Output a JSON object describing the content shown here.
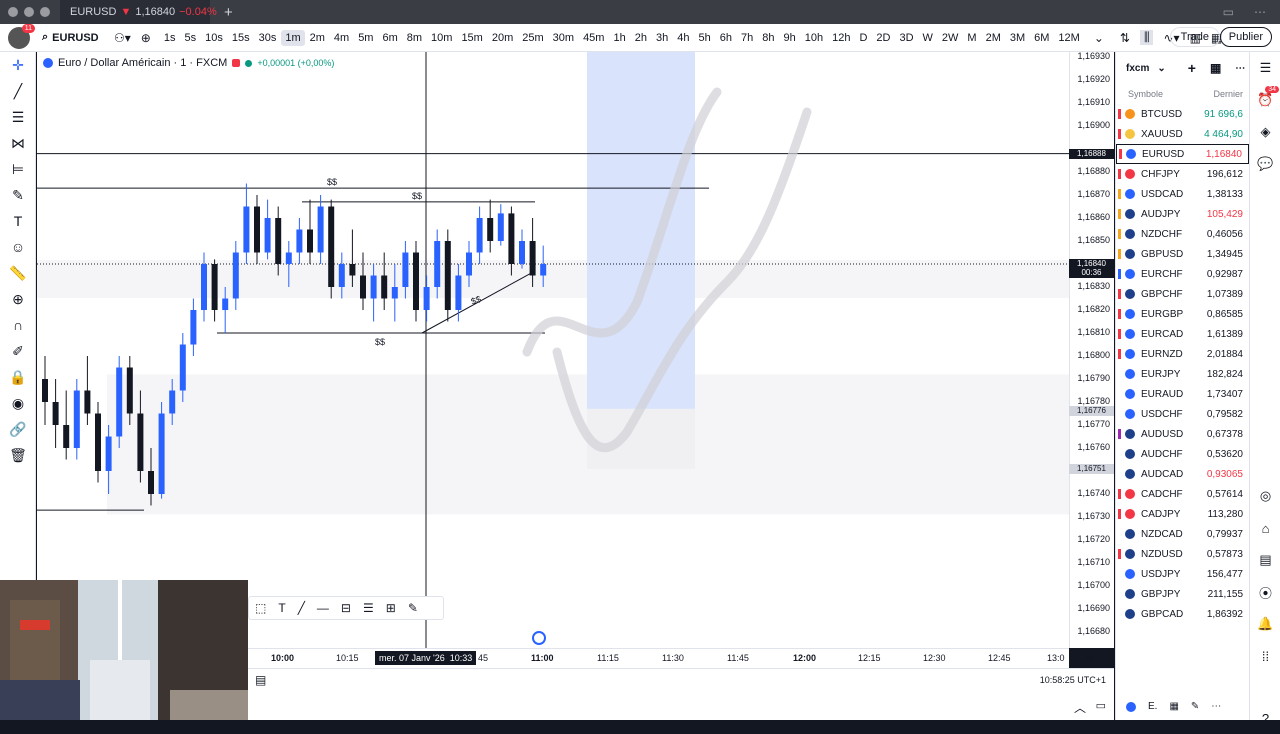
{
  "tab": {
    "symbol": "EURUSD",
    "price": "1,16840",
    "change": "−0.04%"
  },
  "toolbar": {
    "symbol": "EURUSD",
    "notification_count": "11",
    "timeframes": [
      "1s",
      "5s",
      "10s",
      "15s",
      "30s",
      "1m",
      "2m",
      "4m",
      "5m",
      "6m",
      "8m",
      "10m",
      "15m",
      "20m",
      "25m",
      "30m",
      "45m",
      "1h",
      "2h",
      "3h",
      "4h",
      "5h",
      "6h",
      "7h",
      "8h",
      "9h",
      "10h",
      "12h",
      "D",
      "2D",
      "3D",
      "W",
      "2W",
      "M",
      "2M",
      "3M",
      "6M",
      "12M"
    ],
    "active_timeframe": "1m",
    "trade_label": "Trade",
    "publish_label": "Publier"
  },
  "chart": {
    "title": "Euro / Dollar Américain · 1 · FXCM",
    "change": "+0,00001 (+0,00%)",
    "annotations": [
      "$$",
      "$$",
      "$$",
      "$$"
    ],
    "crosshair_date": "mer. 07 Janv '26",
    "crosshair_time": "10:33",
    "hidden_time_fragment": "45"
  },
  "price_axis": {
    "ticks": [
      "1,16930",
      "1,16920",
      "1,16910",
      "1,16900",
      "1,16880",
      "1,16870",
      "1,16860",
      "1,16850",
      "1,16830",
      "1,16820",
      "1,16810",
      "1,16800",
      "1,16790",
      "1,16780",
      "1,16770",
      "1,16760",
      "1,16740",
      "1,16730",
      "1,16720",
      "1,16710",
      "1,16700",
      "1,16690",
      "1,16680"
    ],
    "crosshair_label": "1,16888",
    "last_price_label": "1,16840",
    "countdown": "00:36",
    "level1_label": "1,16776",
    "level2_label": "1,16751"
  },
  "time_axis": {
    "ticks": [
      "10:00",
      "10:15",
      "11:00",
      "11:15",
      "11:30",
      "11:45",
      "12:00",
      "12:15",
      "12:30",
      "12:45",
      "13:0"
    ]
  },
  "clock": "10:58:25 UTC+1",
  "watchlist": {
    "title": "fxcm",
    "col_symbol": "Symbole",
    "col_last": "Dernier",
    "badge": "34",
    "bottom_label": "E.",
    "items": [
      {
        "symbol": "BTCUSD",
        "last": "91 696,6",
        "color": "#089981",
        "flag": "#f23645",
        "icon": "#f7931a"
      },
      {
        "symbol": "XAUUSD",
        "last": "4 464,90",
        "color": "#089981",
        "flag": "#f23645",
        "icon": "#f5c542"
      },
      {
        "symbol": "EURUSD",
        "last": "1,16840",
        "color": "#f23645",
        "flag": "#f23645",
        "icon": "#2962ff"
      },
      {
        "symbol": "CHFJPY",
        "last": "196,612",
        "color": "#131722",
        "flag": "#f23645",
        "icon": "#f23645"
      },
      {
        "symbol": "USDCAD",
        "last": "1,38133",
        "color": "#131722",
        "flag": "#f5a623",
        "icon": "#2962ff"
      },
      {
        "symbol": "AUDJPY",
        "last": "105,429",
        "color": "#f23645",
        "flag": "#f5a623",
        "icon": "#1e3f8a"
      },
      {
        "symbol": "NZDCHF",
        "last": "0,46056",
        "color": "#131722",
        "flag": "#f5a623",
        "icon": "#1e3f8a"
      },
      {
        "symbol": "GBPUSD",
        "last": "1,34945",
        "color": "#131722",
        "flag": "#f5a623",
        "icon": "#1e3f8a"
      },
      {
        "symbol": "EURCHF",
        "last": "0,92987",
        "color": "#131722",
        "flag": "#2962ff",
        "icon": "#2962ff"
      },
      {
        "symbol": "GBPCHF",
        "last": "1,07389",
        "color": "#131722",
        "flag": "#f23645",
        "icon": "#1e3f8a"
      },
      {
        "symbol": "EURGBP",
        "last": "0,86585",
        "color": "#131722",
        "flag": "#f23645",
        "icon": "#2962ff"
      },
      {
        "symbol": "EURCAD",
        "last": "1,61389",
        "color": "#131722",
        "flag": "#f23645",
        "icon": "#2962ff"
      },
      {
        "symbol": "EURNZD",
        "last": "2,01884",
        "color": "#131722",
        "flag": "#f23645",
        "icon": "#2962ff"
      },
      {
        "symbol": "EURJPY",
        "last": "182,824",
        "color": "#131722",
        "flag": "#ffffff",
        "icon": "#2962ff"
      },
      {
        "symbol": "EURAUD",
        "last": "1,73407",
        "color": "#131722",
        "flag": "#ffffff",
        "icon": "#2962ff"
      },
      {
        "symbol": "USDCHF",
        "last": "0,79582",
        "color": "#131722",
        "flag": "#ffffff",
        "icon": "#2962ff"
      },
      {
        "symbol": "AUDUSD",
        "last": "0,67378",
        "color": "#131722",
        "flag": "#9c27b0",
        "icon": "#1e3f8a"
      },
      {
        "symbol": "AUDCHF",
        "last": "0,53620",
        "color": "#131722",
        "flag": "#ffffff",
        "icon": "#1e3f8a"
      },
      {
        "symbol": "AUDCAD",
        "last": "0,93065",
        "color": "#f23645",
        "flag": "#ffffff",
        "icon": "#1e3f8a"
      },
      {
        "symbol": "CADCHF",
        "last": "0,57614",
        "color": "#131722",
        "flag": "#f23645",
        "icon": "#f23645"
      },
      {
        "symbol": "CADJPY",
        "last": "113,280",
        "color": "#131722",
        "flag": "#f23645",
        "icon": "#f23645"
      },
      {
        "symbol": "NZDCAD",
        "last": "0,79937",
        "color": "#131722",
        "flag": "#ffffff",
        "icon": "#1e3f8a"
      },
      {
        "symbol": "NZDUSD",
        "last": "0,57873",
        "color": "#131722",
        "flag": "#f23645",
        "icon": "#1e3f8a"
      },
      {
        "symbol": "USDJPY",
        "last": "156,477",
        "color": "#131722",
        "flag": "#ffffff",
        "icon": "#2962ff"
      },
      {
        "symbol": "GBPJPY",
        "last": "211,155",
        "color": "#131722",
        "flag": "#ffffff",
        "icon": "#1e3f8a"
      },
      {
        "symbol": "GBPCAD",
        "last": "1,86392",
        "color": "#131722",
        "flag": "#ffffff",
        "icon": "#1e3f8a"
      }
    ]
  },
  "icons": [
    "crosshair-icon",
    "trend-line-icon",
    "fib-icon",
    "pattern-icon",
    "brush-icon",
    "text-icon",
    "emoji-icon",
    "ruler-icon",
    "zoom-icon",
    "magnet-icon",
    "lock-icon",
    "eye-icon",
    "link-icon",
    "trash-icon"
  ]
}
